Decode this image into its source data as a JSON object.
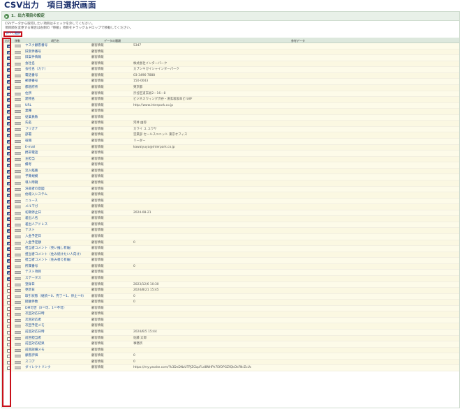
{
  "page": {
    "title": "CSV出力　項目選択画面"
  },
  "section": {
    "label": "1．出力項目の設定",
    "notes": [
      "CSVデータから取得したい項目はチェックを外してください。",
      "項目順を変更する場合は右側の「移動」項目をドラッグ＆ドロップで移動してください。"
    ],
    "check_all_label": "すべて選択"
  },
  "table": {
    "headers": {
      "output": "出力",
      "move": "移動",
      "name": "項目名",
      "type": "データの種類",
      "ref": "参考データ"
    },
    "rows": [
      {
        "checked": true,
        "name": "ヤスク顧客番号",
        "type": "顧客情報",
        "ref": "5347"
      },
      {
        "checked": true,
        "name": "旧案件番号",
        "type": "顧客情報",
        "ref": ""
      },
      {
        "checked": true,
        "name": "旧案件情報",
        "type": "顧客情報",
        "ref": ""
      },
      {
        "checked": true,
        "name": "会社名",
        "type": "顧客情報",
        "ref": "株式会社インターパーク"
      },
      {
        "checked": true,
        "name": "会社名（カナ）",
        "type": "顧客情報",
        "ref": "カブシキガイシャインターパーク"
      },
      {
        "checked": true,
        "name": "電話番号",
        "type": "顧客情報",
        "ref": "03-3496-7888"
      },
      {
        "checked": true,
        "name": "郵便番号",
        "type": "顧客情報",
        "ref": "150-0043"
      },
      {
        "checked": true,
        "name": "都道府県",
        "type": "顧客情報",
        "ref": "東京都"
      },
      {
        "checked": true,
        "name": "住所",
        "type": "顧客情報",
        "ref": "渋谷区道玄坂2－16－8"
      },
      {
        "checked": true,
        "name": "建物名",
        "type": "顧客情報",
        "ref": "ビジネスウィング渋谷・道玄坂坂本ビル8F"
      },
      {
        "checked": true,
        "name": "URL",
        "type": "顧客情報",
        "ref": "http://www.interpark.co.jp"
      },
      {
        "checked": true,
        "name": "業種",
        "type": "顧客情報",
        "ref": ""
      },
      {
        "checked": true,
        "name": "従業員数",
        "type": "顧客情報",
        "ref": ""
      },
      {
        "checked": true,
        "name": "氏名",
        "type": "顧客情報",
        "ref": "河井 由弥"
      },
      {
        "checked": true,
        "name": "フリガナ",
        "type": "顧客情報",
        "ref": "カワイ ユ ユウヤ"
      },
      {
        "checked": true,
        "name": "部署",
        "type": "顧客情報",
        "ref": "営業部 セールスユニット 東京オフィス"
      },
      {
        "checked": true,
        "name": "役職",
        "type": "顧客情報",
        "ref": "リーダー"
      },
      {
        "checked": true,
        "name": "E-mail",
        "type": "顧客情報",
        "ref": "kawaiyuya@interpark.co.jp"
      },
      {
        "checked": true,
        "name": "携帯電話",
        "type": "顧客情報",
        "ref": ""
      },
      {
        "checked": true,
        "name": "主担当",
        "type": "顧客情報",
        "ref": ""
      },
      {
        "checked": true,
        "name": "備考",
        "type": "顧客情報",
        "ref": ""
      },
      {
        "checked": true,
        "name": "流入経路",
        "type": "顧客情報",
        "ref": ""
      },
      {
        "checked": true,
        "name": "予算規模",
        "type": "顧客情報",
        "ref": ""
      },
      {
        "checked": true,
        "name": "導入時期",
        "type": "顧客情報",
        "ref": ""
      },
      {
        "checked": true,
        "name": "決裁者の意図",
        "type": "顧客情報",
        "ref": ""
      },
      {
        "checked": true,
        "name": "他導入システム",
        "type": "顧客情報",
        "ref": ""
      },
      {
        "checked": true,
        "name": "ニュース",
        "type": "顧客情報",
        "ref": ""
      },
      {
        "checked": true,
        "name": "メルマガ",
        "type": "顧客情報",
        "ref": ""
      },
      {
        "checked": true,
        "name": "初期停止日",
        "type": "顧客情報",
        "ref": "2024-08-21"
      },
      {
        "checked": true,
        "name": "差出人名",
        "type": "顧客情報",
        "ref": ""
      },
      {
        "checked": true,
        "name": "差出人アドレス",
        "type": "顧客情報",
        "ref": ""
      },
      {
        "checked": true,
        "name": "テスト",
        "type": "顧客情報",
        "ref": ""
      },
      {
        "checked": true,
        "name": "入金予定日",
        "type": "顧客情報",
        "ref": ""
      },
      {
        "checked": true,
        "name": "入金予定額",
        "type": "顧客情報",
        "ref": "0"
      },
      {
        "checked": true,
        "name": "担当者コメント（売い推し有破）",
        "type": "顧客情報",
        "ref": ""
      },
      {
        "checked": true,
        "name": "担当者コメント（住み続けたい人向け）",
        "type": "顧客情報",
        "ref": ""
      },
      {
        "checked": true,
        "name": "担当者コメント（住み替え有破）",
        "type": "顧客情報",
        "ref": ""
      },
      {
        "checked": true,
        "name": "所属番号",
        "type": "顧客情報",
        "ref": "0"
      },
      {
        "checked": true,
        "name": "テスト項目",
        "type": "顧客情報",
        "ref": ""
      },
      {
        "checked": true,
        "name": "ステータス",
        "type": "顧客情報",
        "ref": ""
      },
      {
        "checked": false,
        "name": "登録日",
        "type": "顧客情報",
        "ref": "2023/12/6 10:30"
      },
      {
        "checked": false,
        "name": "更新日",
        "type": "顧客情報",
        "ref": "2024/8/21 15:45"
      },
      {
        "checked": false,
        "name": "取引状態（継続＝0、完了＝1、停止＝9）",
        "type": "顧客情報",
        "ref": "0"
      },
      {
        "checked": false,
        "name": "接触件数",
        "type": "顧客情報",
        "ref": "0"
      },
      {
        "checked": false,
        "name": "DM可否（0＝可、1＝不可）",
        "type": "顧客情報",
        "ref": ""
      },
      {
        "checked": false,
        "name": "次回対応日時",
        "type": "顧客情報",
        "ref": ""
      },
      {
        "checked": false,
        "name": "次回対応者",
        "type": "顧客情報",
        "ref": ""
      },
      {
        "checked": false,
        "name": "次回予定メモ",
        "type": "顧客情報",
        "ref": ""
      },
      {
        "checked": false,
        "name": "前回対応日時",
        "type": "顧客情報",
        "ref": "2024/6/5 15:44"
      },
      {
        "checked": false,
        "name": "前回担当者",
        "type": "顧客情報",
        "ref": "佐藤 太郎"
      },
      {
        "checked": false,
        "name": "前回対応結果",
        "type": "顧客情報",
        "ref": "事務所"
      },
      {
        "checked": false,
        "name": "前回詳細メモ",
        "type": "顧客情報",
        "ref": ""
      },
      {
        "checked": false,
        "name": "顧客評価",
        "type": "顧客情報",
        "ref": "0"
      },
      {
        "checked": false,
        "name": "スコア",
        "type": "顧客情報",
        "ref": "0"
      },
      {
        "checked": false,
        "name": "ダイレクトリンク",
        "type": "顧客情報",
        "ref": "https://my.yasske.com/?k3DnDNzUTPJZCbpFLd8NHPh7EfOPGZfQkOkFNrZcUc"
      }
    ]
  }
}
